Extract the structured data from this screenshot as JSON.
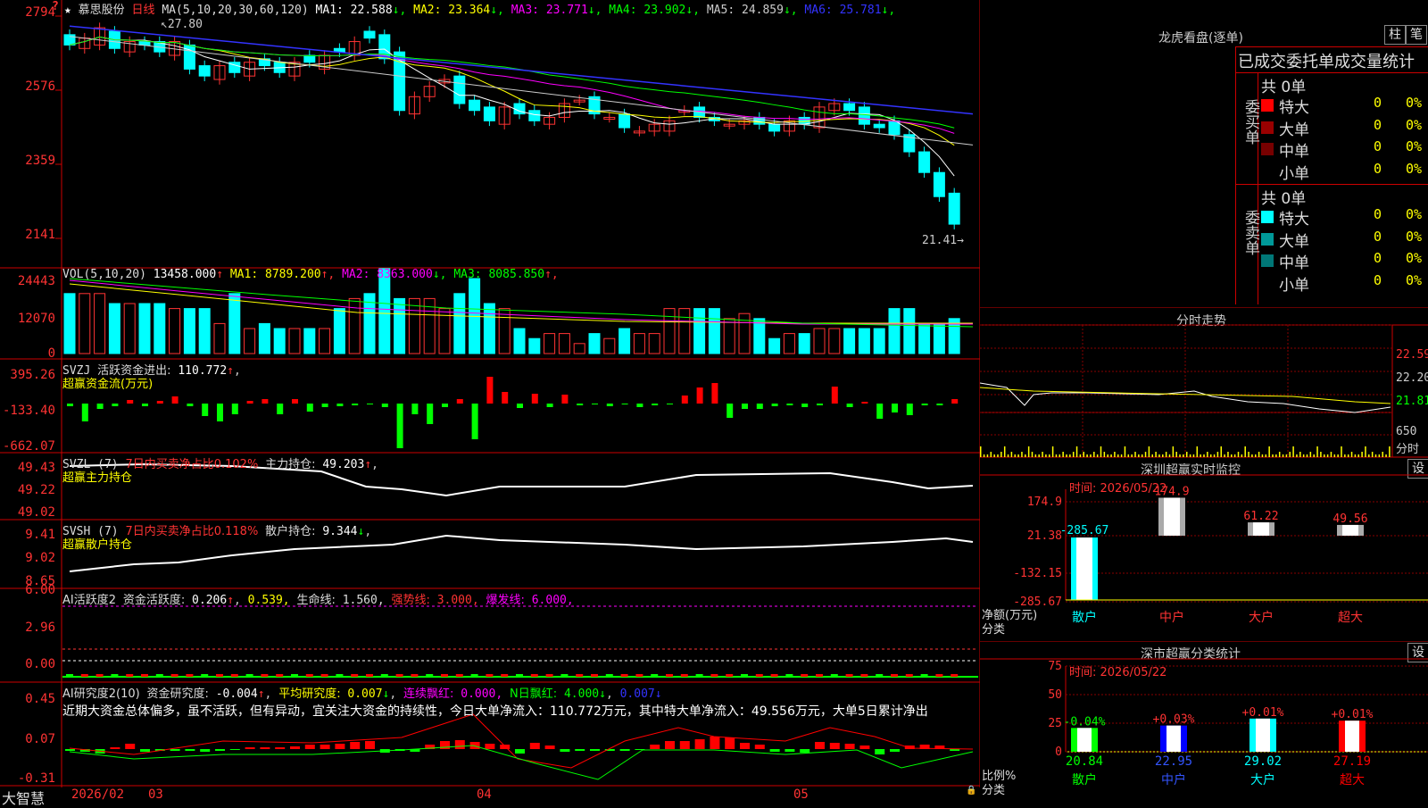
{
  "header": {
    "stock_name": "慕思股份",
    "period": "日线",
    "ma_params": "MA(5,10,20,30,60,120)",
    "ma": [
      {
        "label": "MA1:",
        "value": "22.588",
        "arrow": "↓",
        "color": "#ffffff"
      },
      {
        "label": "MA2:",
        "value": "23.364",
        "arrow": "↓",
        "color": "#ffff00"
      },
      {
        "label": "MA3:",
        "value": "23.771",
        "arrow": "↓",
        "color": "#ff00ff"
      },
      {
        "label": "MA4:",
        "value": "23.902",
        "arrow": "↓",
        "color": "#00ff00"
      },
      {
        "label": "MA5:",
        "value": "24.859",
        "arrow": "↓",
        "color": "#cccccc"
      },
      {
        "label": "MA6:",
        "value": "25.781",
        "arrow": "↓",
        "color": "#3333ff"
      }
    ],
    "star": "★",
    "alert": "?"
  },
  "price_axis": [
    "2794",
    "2576",
    "2359",
    "2141"
  ],
  "price_marks": {
    "high": "27.80",
    "low": "21.41"
  },
  "vol": {
    "title": "VOL(5,10,20)",
    "value": "13458.000",
    "ma": [
      {
        "label": "MA1:",
        "value": "8789.200",
        "arrow": "↑",
        "color": "#ffff00"
      },
      {
        "label": "MA2:",
        "value": "8363.000",
        "arrow": "↓",
        "color": "#ff00ff"
      },
      {
        "label": "MA3:",
        "value": "8085.850",
        "arrow": "↑",
        "color": "#00ff00"
      }
    ],
    "axis": [
      "24443",
      "12070",
      "0"
    ]
  },
  "svzj": {
    "title": "SVZJ",
    "line1": "活跃资金进出:",
    "value": "110.772",
    "arrow": "↑",
    "line2": "超赢资金流(万元)",
    "axis": [
      "395.26",
      "-133.40",
      "-662.07"
    ]
  },
  "svzl": {
    "title": "SVZL (7)",
    "t2": "7日内买卖净占比0.102%",
    "t3": "主力持仓:",
    "value": "49.203",
    "arrow": "↑",
    "line2": "超赢主力持仓",
    "axis": [
      "49.43",
      "49.22",
      "49.02"
    ]
  },
  "svsh": {
    "title": "SVSH (7)",
    "t2": "7日内买卖净占比0.118%",
    "t3": "散户持仓:",
    "value": "9.344",
    "arrow": "↓",
    "line2": "超赢散户持仓",
    "axis": [
      "9.41",
      "9.02",
      "8.65"
    ]
  },
  "ai1": {
    "title": "AI活跃度2",
    "t1": "资金活跃度:",
    "v1": "0.206",
    "a1": "↑",
    "v2": "0.539,",
    "t3": "生命线:",
    "v3": "1.560,",
    "t4": "强势线:",
    "v4": "3.000,",
    "t5": "爆发线:",
    "v5": "6.000,",
    "axis": [
      "6.00",
      "2.96",
      "0.00"
    ]
  },
  "ai2": {
    "title": "AI研究度2(10)",
    "t1": "资金研究度:",
    "v1": "-0.004",
    "a1": "↑",
    "t2": "平均研究度:",
    "v2": "0.007",
    "a2": "↓",
    "t3": "连续飘红:",
    "v3": "0.000,",
    "t4": "N日飘红:",
    "v4": "4.000",
    "a4": "↓",
    "v5": "0.007",
    "a5": "↓",
    "text": "近期大资金总体偏多，虽不活跃，但有异动，宜关注大资金的持续性，今日大单净流入：110.772万元，其中特大单净流入：49.556万元，大单5日累计净出",
    "axis": [
      "0.45",
      "0.07",
      "-0.31"
    ]
  },
  "bottom": {
    "brand": "大智慧",
    "dates": [
      "2026/02",
      "03",
      "04",
      "05"
    ]
  },
  "dragon": {
    "title": "龙虎看盘(逐单)",
    "btn1": "柱",
    "btn2": "笔",
    "subtitle": "已成交委托单成交量统计",
    "buy_label": "委买单",
    "sell_label": "委卖单",
    "buy_total": "共 0单",
    "sell_total": "共 0单",
    "buy": [
      {
        "name": "特大",
        "qty": "0",
        "pct": "0%",
        "color": "#ff0000"
      },
      {
        "name": "大单",
        "qty": "0",
        "pct": "0%",
        "color": "#990000"
      },
      {
        "name": "中单",
        "qty": "0",
        "pct": "0%",
        "color": "#770000"
      },
      {
        "name": "小单",
        "qty": "0",
        "pct": "0%",
        "color": "#000000"
      }
    ],
    "sell": [
      {
        "name": "特大",
        "qty": "0",
        "pct": "0%",
        "color": "#00ffff"
      },
      {
        "name": "大单",
        "qty": "0",
        "pct": "0%",
        "color": "#009999"
      },
      {
        "name": "中单",
        "qty": "0",
        "pct": "0%",
        "color": "#007777"
      },
      {
        "name": "小单",
        "qty": "0",
        "pct": "0%",
        "color": "#000000"
      }
    ]
  },
  "intraday": {
    "title": "分时走势",
    "axis": [
      "22.59",
      "22.20",
      "21.81"
    ],
    "vol_label": "650",
    "vol_unit": "分时"
  },
  "monitor": {
    "title": "深圳超赢实时监控",
    "btn": "设",
    "time": "时间: 2026/05/22",
    "axis": [
      "174.9",
      "21.38",
      "-132.15",
      "-285.67"
    ],
    "ylabel": "净额(万元)",
    "xlabel": "分类",
    "categories": [
      "散户",
      "中户",
      "大户",
      "超大"
    ],
    "values": [
      -285.67,
      174.9,
      61.22,
      49.56
    ],
    "value_labels": [
      "-285.67",
      "174.9",
      "61.22",
      "49.56"
    ]
  },
  "classify": {
    "title": "深市超赢分类统计",
    "btn": "设",
    "time": "时间: 2026/05/22",
    "axis": [
      "75",
      "50",
      "25",
      "0"
    ],
    "ylabel": "比例%",
    "xlabel": "分类",
    "categories": [
      "散户",
      "中户",
      "大户",
      "超大"
    ],
    "values": [
      20.84,
      22.95,
      29.02,
      27.19
    ],
    "value_labels": [
      "20.84",
      "22.95",
      "29.02",
      "27.19"
    ],
    "changes": [
      "-0.04%",
      "+0.03%",
      "+0.01%",
      "+0.01%"
    ]
  }
}
